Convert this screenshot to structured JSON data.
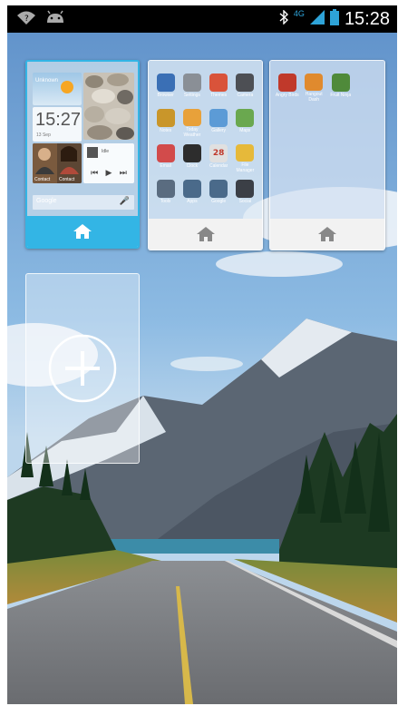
{
  "status_bar": {
    "time": "15:28",
    "network": "4G",
    "icons": [
      "wifi-question-icon",
      "android-debug-icon",
      "bluetooth-icon",
      "signal-icon",
      "battery-icon"
    ]
  },
  "screens": [
    {
      "selected": true,
      "home_icon": "home-icon",
      "widgets": {
        "weather_label": "Unknown",
        "clock_time": "15:27",
        "clock_date": "13 Sep",
        "contacts": [
          "Contact",
          "Contact"
        ],
        "music_title": "Idle",
        "search_label": "Google"
      }
    },
    {
      "selected": false,
      "home_icon": "home-icon",
      "apps": [
        {
          "label": "Browser",
          "icon": "globe-icon",
          "color": "#3a6fb5"
        },
        {
          "label": "Settings",
          "icon": "gear-icon",
          "color": "#8a8f96"
        },
        {
          "label": "Themes",
          "icon": "palette-icon",
          "color": "#d9533a"
        },
        {
          "label": "Camera",
          "icon": "camera-icon",
          "color": "#4d4f54"
        },
        {
          "label": "Notes",
          "icon": "notes-icon",
          "color": "#c9962a"
        },
        {
          "label": "Today Weather",
          "icon": "weather-icon",
          "color": "#e8a13a"
        },
        {
          "label": "Gallery",
          "icon": "gallery-icon",
          "color": "#5c9bd6"
        },
        {
          "label": "Maps",
          "icon": "map-icon",
          "color": "#6aa84f"
        },
        {
          "label": "Email",
          "icon": "email-icon",
          "color": "#d24b4b"
        },
        {
          "label": "Clock",
          "icon": "clock-icon",
          "color": "#2d2d2d"
        },
        {
          "label": "Calendar",
          "icon": "calendar-icon",
          "color": "#e0e0e0",
          "glyph": "28"
        },
        {
          "label": "File Manager",
          "icon": "folder-icon",
          "color": "#e6b93a"
        },
        {
          "label": "Tools",
          "icon": "tools-folder-icon",
          "color": "#5a6c80"
        },
        {
          "label": "Apps",
          "icon": "apps-folder-icon",
          "color": "#4a6a8a"
        },
        {
          "label": "Google",
          "icon": "google-folder-icon",
          "color": "#4a6a8a"
        },
        {
          "label": "Social",
          "icon": "social-folder-icon",
          "color": "#3b3f46"
        }
      ]
    },
    {
      "selected": false,
      "home_icon": "home-icon",
      "apps": [
        {
          "label": "Angry Birds",
          "icon": "angry-birds-icon",
          "color": "#c0392b"
        },
        {
          "label": "Hangout Dash",
          "icon": "game-icon",
          "color": "#e08a2e"
        },
        {
          "label": "Fruit Ninja",
          "icon": "fruit-icon",
          "color": "#4f8a3a"
        }
      ]
    }
  ],
  "add_screen": {
    "icon": "plus-icon"
  }
}
